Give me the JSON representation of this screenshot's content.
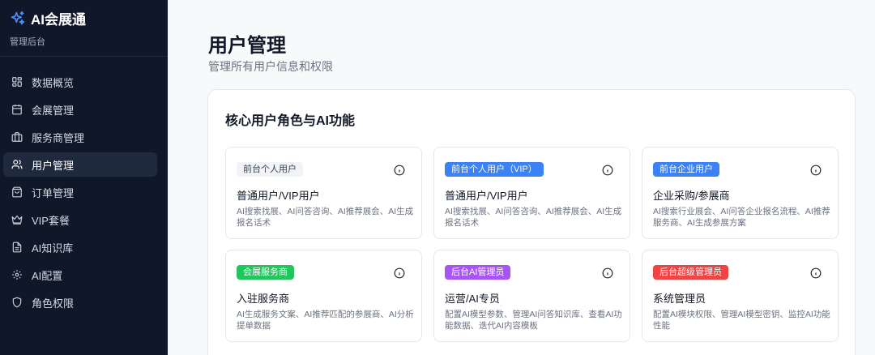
{
  "brand": {
    "title": "AI会展通",
    "subtitle": "管理后台"
  },
  "nav": [
    {
      "label": "数据概览",
      "icon": "dashboard-grid-icon"
    },
    {
      "label": "会展管理",
      "icon": "calendar-icon"
    },
    {
      "label": "服务商管理",
      "icon": "briefcase-icon"
    },
    {
      "label": "用户管理",
      "icon": "users-icon",
      "active": true
    },
    {
      "label": "订单管理",
      "icon": "shopping-bag-icon"
    },
    {
      "label": "VIP套餐",
      "icon": "crown-icon"
    },
    {
      "label": "AI知识库",
      "icon": "document-icon"
    },
    {
      "label": "AI配置",
      "icon": "gear-icon"
    },
    {
      "label": "角色权限",
      "icon": "shield-icon"
    }
  ],
  "page": {
    "title": "用户管理",
    "subtitle": "管理所有用户信息和权限"
  },
  "panel": {
    "title": "核心用户角色与AI功能"
  },
  "cards": [
    {
      "badge": "前台个人用户",
      "badge_color": "#f1f3f6",
      "title": "普通用户/VIP用户",
      "desc": "AI搜索找展、AI问答咨询、AI推荐展会、AI生成报名话术"
    },
    {
      "badge": "前台个人用户（VIP）",
      "badge_color": "#3b82f6",
      "title": "普通用户/VIP用户",
      "desc": "AI搜索找展、AI问答咨询、AI推荐展会、AI生成报名话术"
    },
    {
      "badge": "前台企业用户",
      "badge_color": "#3b82f6",
      "title": "企业采购/参展商",
      "desc": "AI搜索行业展会、AI问答企业报名流程、AI推荐服务商、AI生成参展方案"
    },
    {
      "badge": "会展服务商",
      "badge_color": "#22c55e",
      "title": "入驻服务商",
      "desc": "AI生成服务文案、AI推荐匹配的参展商、AI分析提单数据"
    },
    {
      "badge": "后台AI管理员",
      "badge_color": "#a855f7",
      "title": "运营/AI专员",
      "desc": "配置AI模型参数、管理AI问答知识库、查看AI功能数据、迭代AI内容模板"
    },
    {
      "badge": "后台超级管理员",
      "badge_color": "#ef4444",
      "title": "系统管理员",
      "desc": "配置AI模块权限、管理AI模型密钥、监控AI功能性能"
    }
  ]
}
